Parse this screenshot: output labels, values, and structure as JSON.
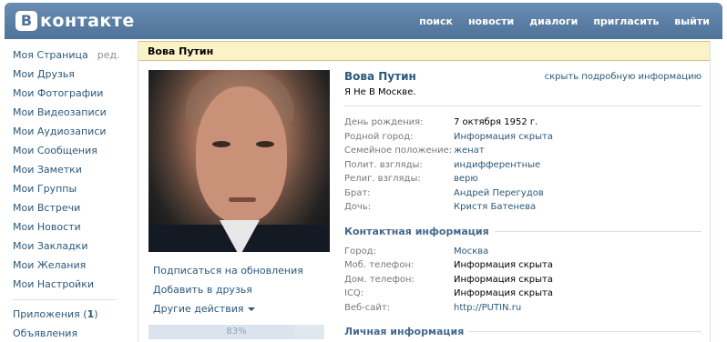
{
  "header": {
    "logo_letter": "B",
    "logo_text": "контакте",
    "nav": [
      "поиск",
      "новости",
      "диалоги",
      "пригласить",
      "выйти"
    ]
  },
  "sidebar": {
    "items": [
      {
        "label": "Моя Страница",
        "extra": "ред."
      },
      {
        "label": "Мои Друзья"
      },
      {
        "label": "Мои Фотографии"
      },
      {
        "label": "Мои Видеозаписи"
      },
      {
        "label": "Мои Аудиозаписи"
      },
      {
        "label": "Мои Сообщения"
      },
      {
        "label": "Мои Заметки"
      },
      {
        "label": "Мои Группы"
      },
      {
        "label": "Мои Встречи"
      },
      {
        "label": "Мои Новости"
      },
      {
        "label": "Мои Закладки"
      },
      {
        "label": "Мои Желания"
      },
      {
        "label": "Мои Настройки"
      }
    ],
    "apps_label": "Приложения (",
    "apps_count": "1",
    "apps_close": ")",
    "ads_label": "Объявления"
  },
  "profile": {
    "title": "Вова Путин",
    "name": "Вова Путин",
    "hide_link": "скрыть подробную информацию",
    "status": "Я Не В Москве.",
    "actions": {
      "subscribe": "Подписаться на обновления",
      "add_friend": "Добавить в друзья",
      "other": "Другие действия"
    },
    "rating": "83%",
    "rating_fraction": 0.83,
    "basic": [
      {
        "k": "День рождения:",
        "v": "7 октября 1952 г.",
        "link": false
      },
      {
        "k": "Родной город:",
        "v": "Информация скрыта",
        "link": true
      },
      {
        "k": "Семейное положение:",
        "v": "женат",
        "link": true
      },
      {
        "k": "Полит. взгляды:",
        "v": "индифферентные",
        "link": true
      },
      {
        "k": "Религ. взгляды:",
        "v": "верю",
        "link": true
      },
      {
        "k": "Брат:",
        "v": "Андрей Перегудов",
        "link": true
      },
      {
        "k": "Дочь:",
        "v": "Кристя Батенева",
        "link": true
      }
    ],
    "contact_title": "Контактная информация",
    "contact": [
      {
        "k": "Город:",
        "v": "Москва",
        "link": true
      },
      {
        "k": "Моб. телефон:",
        "v": "Информация скрыта",
        "link": false
      },
      {
        "k": "Дом. телефон:",
        "v": "Информация скрыта",
        "link": false
      },
      {
        "k": "ICQ:",
        "v": "Информация скрыта",
        "link": false
      },
      {
        "k": "Веб-сайт:",
        "v": "http://PUTIN.ru",
        "link": true
      }
    ],
    "personal_title": "Личная информация"
  }
}
